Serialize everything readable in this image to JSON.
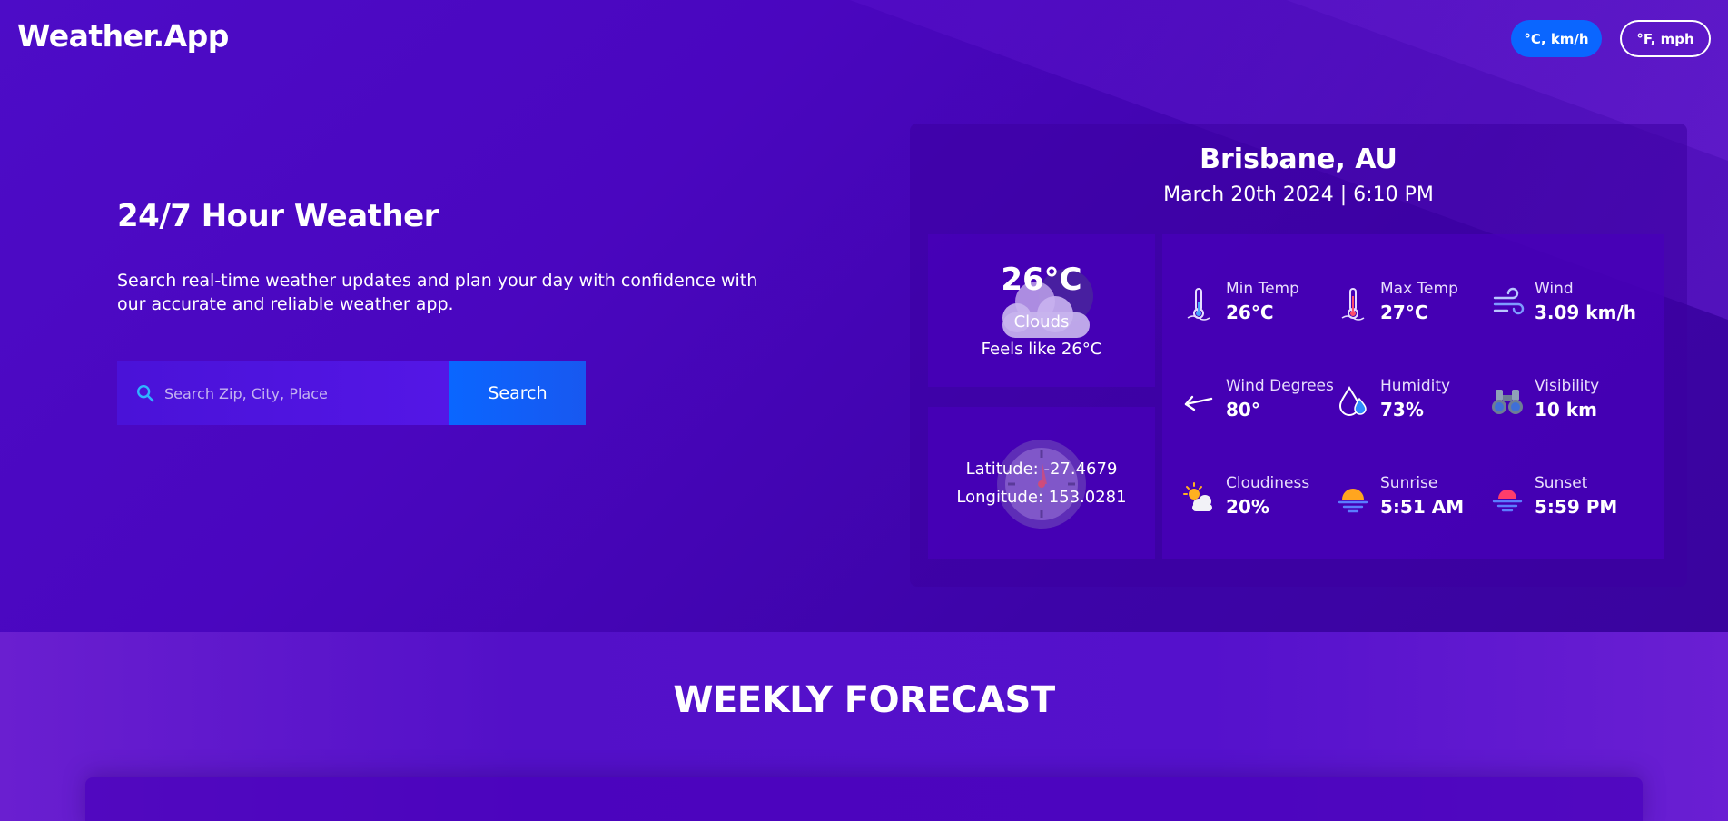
{
  "app": {
    "logo": "Weather.App"
  },
  "units": {
    "metric_label": "°C, km/h",
    "imperial_label": "°F, mph",
    "accent": "#0a66ff"
  },
  "hero": {
    "title": "24/7 Hour Weather",
    "description": "Search real-time weather updates and plan your day with confidence with our accurate and reliable weather app."
  },
  "search": {
    "placeholder": "Search Zip, City, Place",
    "value": "",
    "button_label": "Search",
    "icon": "search-icon"
  },
  "current": {
    "city": "Brisbane, AU",
    "datetime": "March 20th 2024 | 6:10 PM",
    "temp": "26°C",
    "condition": "Clouds",
    "feels_like": "Feels like 26°C",
    "latitude": "Latitude: -27.4679",
    "longitude": "Longitude: 153.0281"
  },
  "stats": [
    {
      "label": "Min Temp",
      "value": "26°C",
      "icon": "thermometer-low-icon"
    },
    {
      "label": "Max Temp",
      "value": "27°C",
      "icon": "thermometer-high-icon"
    },
    {
      "label": "Wind",
      "value": "3.09 km/h",
      "icon": "wind-icon"
    },
    {
      "label": "Wind Degrees",
      "value": "80°",
      "icon": "wind-direction-arrow-icon"
    },
    {
      "label": "Humidity",
      "value": "73%",
      "icon": "humidity-drop-icon"
    },
    {
      "label": "Visibility",
      "value": "10 km",
      "icon": "binoculars-icon"
    },
    {
      "label": "Cloudiness",
      "value": "20%",
      "icon": "partly-cloudy-icon"
    },
    {
      "label": "Sunrise",
      "value": "5:51 AM",
      "icon": "sunrise-icon"
    },
    {
      "label": "Sunset",
      "value": "5:59 PM",
      "icon": "sunset-icon"
    }
  ],
  "weekly": {
    "title": "WEEKLY FORECAST"
  }
}
